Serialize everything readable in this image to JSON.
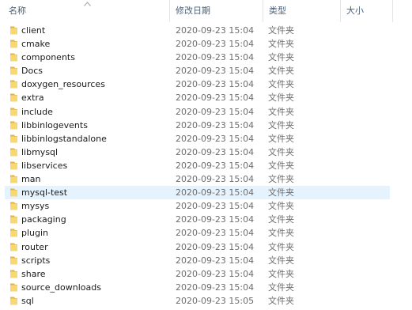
{
  "header": {
    "name_label": "名称",
    "date_label": "修改日期",
    "type_label": "类型",
    "size_label": "大小"
  },
  "icons": {
    "folder": "folder-icon",
    "sort": "sort-up-chevron-icon"
  },
  "colors": {
    "folder_yellow": "#f5c54a",
    "hover_bg": "#e5f3ff",
    "header_text": "#4c607a"
  },
  "rows": [
    {
      "name": "client",
      "date": "2020-09-23 15:04",
      "type": "文件夹"
    },
    {
      "name": "cmake",
      "date": "2020-09-23 15:04",
      "type": "文件夹"
    },
    {
      "name": "components",
      "date": "2020-09-23 15:04",
      "type": "文件夹"
    },
    {
      "name": "Docs",
      "date": "2020-09-23 15:04",
      "type": "文件夹"
    },
    {
      "name": "doxygen_resources",
      "date": "2020-09-23 15:04",
      "type": "文件夹"
    },
    {
      "name": "extra",
      "date": "2020-09-23 15:04",
      "type": "文件夹"
    },
    {
      "name": "include",
      "date": "2020-09-23 15:04",
      "type": "文件夹"
    },
    {
      "name": "libbinlogevents",
      "date": "2020-09-23 15:04",
      "type": "文件夹"
    },
    {
      "name": "libbinlogstandalone",
      "date": "2020-09-23 15:04",
      "type": "文件夹"
    },
    {
      "name": "libmysql",
      "date": "2020-09-23 15:04",
      "type": "文件夹"
    },
    {
      "name": "libservices",
      "date": "2020-09-23 15:04",
      "type": "文件夹"
    },
    {
      "name": "man",
      "date": "2020-09-23 15:04",
      "type": "文件夹"
    },
    {
      "name": "mysql-test",
      "date": "2020-09-23 15:04",
      "type": "文件夹",
      "hovered": true
    },
    {
      "name": "mysys",
      "date": "2020-09-23 15:04",
      "type": "文件夹"
    },
    {
      "name": "packaging",
      "date": "2020-09-23 15:04",
      "type": "文件夹"
    },
    {
      "name": "plugin",
      "date": "2020-09-23 15:04",
      "type": "文件夹"
    },
    {
      "name": "router",
      "date": "2020-09-23 15:04",
      "type": "文件夹"
    },
    {
      "name": "scripts",
      "date": "2020-09-23 15:04",
      "type": "文件夹"
    },
    {
      "name": "share",
      "date": "2020-09-23 15:04",
      "type": "文件夹"
    },
    {
      "name": "source_downloads",
      "date": "2020-09-23 15:04",
      "type": "文件夹"
    },
    {
      "name": "sql",
      "date": "2020-09-23 15:05",
      "type": "文件夹"
    }
  ]
}
